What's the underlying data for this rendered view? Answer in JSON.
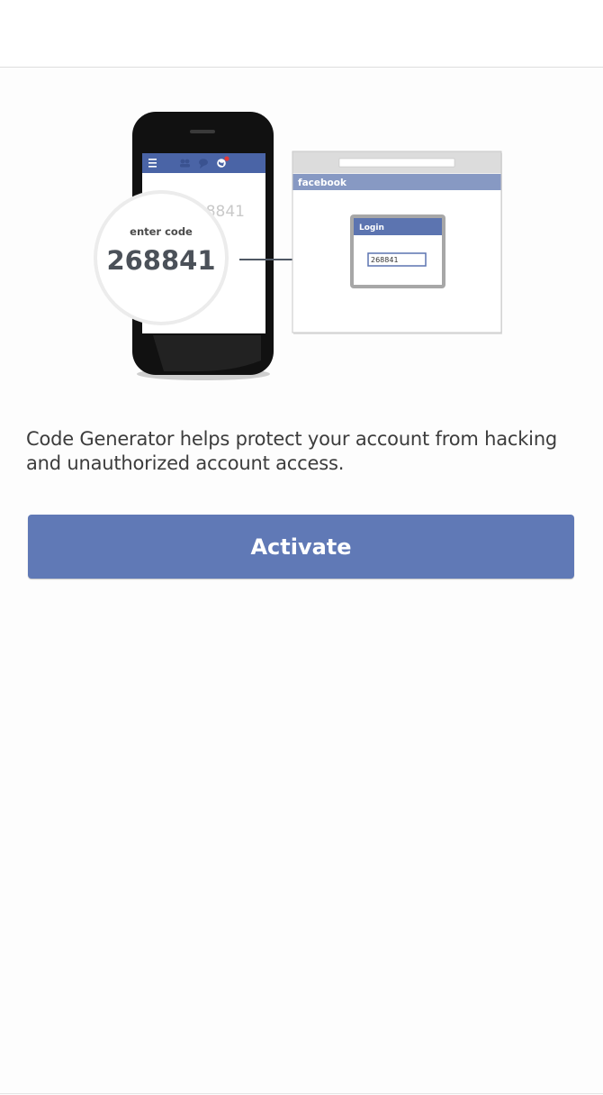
{
  "illustration": {
    "phone_code_partial": "8841",
    "bubble_label": "enter code",
    "bubble_code": "268841",
    "browser_brand": "facebook",
    "login_title": "Login",
    "login_code": "268841"
  },
  "description": "Code Generator helps protect your account from hacking and unauthorized account access.",
  "activate_label": "Activate",
  "colors": {
    "brand_blue": "#6079b6",
    "phone_body": "#111111",
    "text_dark": "#3c3c3c"
  }
}
